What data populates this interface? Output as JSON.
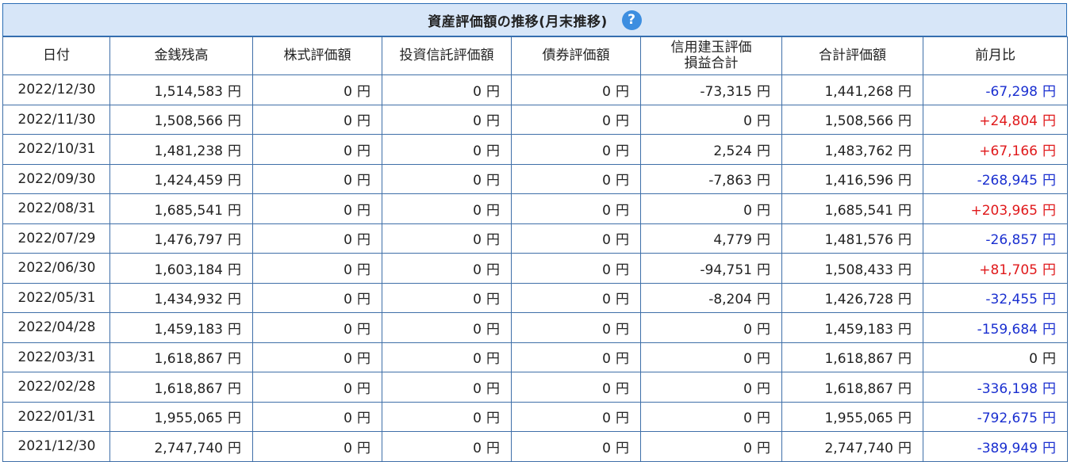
{
  "title": "資産評価額の推移(月末推移)",
  "help_icon": "?",
  "columns": [
    "日付",
    "金銭残高",
    "株式評価額",
    "投資信託評価額",
    "債券評価額",
    "信用建玉評価\n損益合計",
    "合計評価額",
    "前月比"
  ],
  "currency": "円",
  "colors": {
    "negative": "#1a2fd0",
    "positive": "#e0191b"
  },
  "rows": [
    [
      "2022/12/30",
      "1,514,583",
      "0",
      "0",
      "0",
      "-73,315",
      "1,441,268",
      "-67,298"
    ],
    [
      "2022/11/30",
      "1,508,566",
      "0",
      "0",
      "0",
      "0",
      "1,508,566",
      "+24,804"
    ],
    [
      "2022/10/31",
      "1,481,238",
      "0",
      "0",
      "0",
      "2,524",
      "1,483,762",
      "+67,166"
    ],
    [
      "2022/09/30",
      "1,424,459",
      "0",
      "0",
      "0",
      "-7,863",
      "1,416,596",
      "-268,945"
    ],
    [
      "2022/08/31",
      "1,685,541",
      "0",
      "0",
      "0",
      "0",
      "1,685,541",
      "+203,965"
    ],
    [
      "2022/07/29",
      "1,476,797",
      "0",
      "0",
      "0",
      "4,779",
      "1,481,576",
      "-26,857"
    ],
    [
      "2022/06/30",
      "1,603,184",
      "0",
      "0",
      "0",
      "-94,751",
      "1,508,433",
      "+81,705"
    ],
    [
      "2022/05/31",
      "1,434,932",
      "0",
      "0",
      "0",
      "-8,204",
      "1,426,728",
      "-32,455"
    ],
    [
      "2022/04/28",
      "1,459,183",
      "0",
      "0",
      "0",
      "0",
      "1,459,183",
      "-159,684"
    ],
    [
      "2022/03/31",
      "1,618,867",
      "0",
      "0",
      "0",
      "0",
      "1,618,867",
      "0"
    ],
    [
      "2022/02/28",
      "1,618,867",
      "0",
      "0",
      "0",
      "0",
      "1,618,867",
      "-336,198"
    ],
    [
      "2022/01/31",
      "1,955,065",
      "0",
      "0",
      "0",
      "0",
      "1,955,065",
      "-792,675"
    ],
    [
      "2021/12/30",
      "2,747,740",
      "0",
      "0",
      "0",
      "0",
      "2,747,740",
      "-389,949"
    ]
  ]
}
